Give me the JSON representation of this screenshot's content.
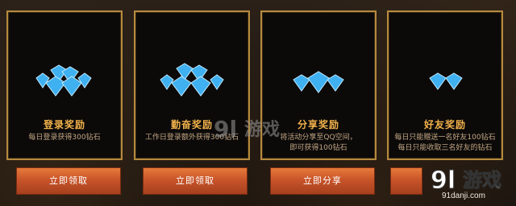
{
  "cards": [
    {
      "title": "登录奖励",
      "desc": [
        "每日登录获得300钻石"
      ],
      "button": "立即领取"
    },
    {
      "title": "勤奋奖励",
      "desc": [
        "工作日登录额外获得300钻石"
      ],
      "button": "立即领取"
    },
    {
      "title": "分享奖励",
      "desc": [
        "将活动分享至QQ空间，",
        "即可获得100钻石"
      ],
      "button": "立即分享"
    },
    {
      "title": "好友奖励",
      "desc": [
        "每日只能赠送一名好友100钻石",
        "每日只能收取三名好友的钻石"
      ],
      "button": ""
    }
  ],
  "watermark": {
    "logo_text": "9l游戏",
    "site": "91danji.com"
  },
  "colors": {
    "border": "#b58a3e",
    "title": "#f2b24b",
    "button": "#c8542a",
    "gem": "#3fb0f0"
  },
  "icons": {
    "reward": "diamond-cluster-icon"
  }
}
